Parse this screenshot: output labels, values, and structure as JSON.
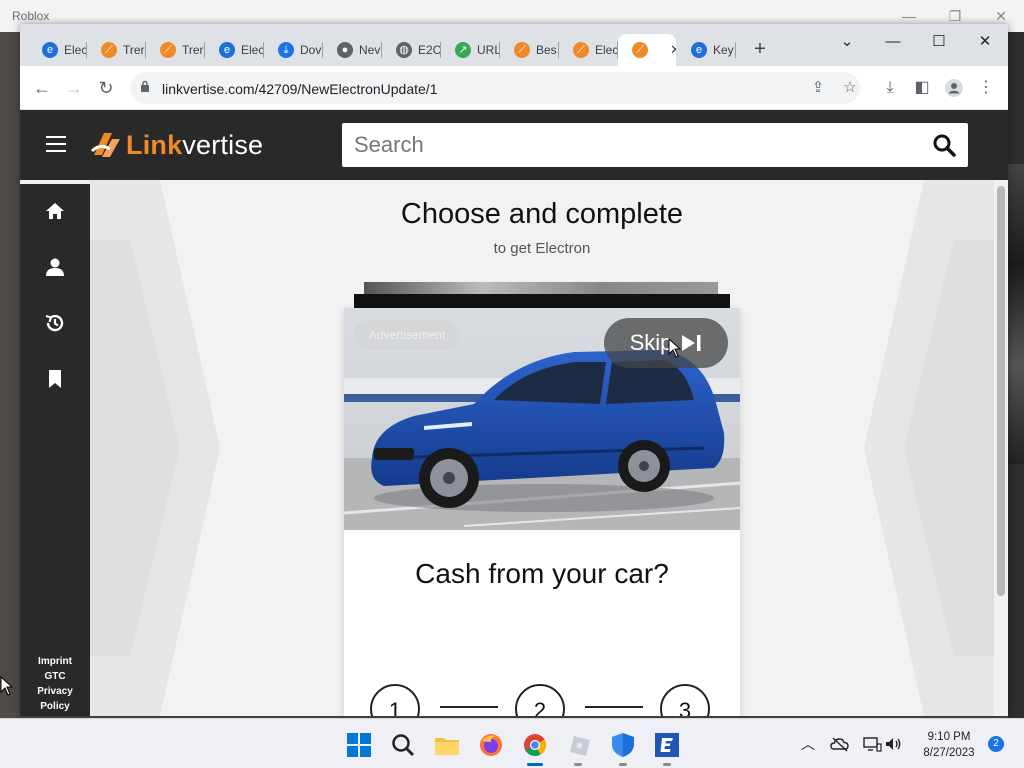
{
  "background_window": {
    "title": "Roblox"
  },
  "browser": {
    "tabs": [
      {
        "label": "Elec",
        "icon": "electron-icon",
        "active": false
      },
      {
        "label": "Trer",
        "icon": "linkvertise-icon",
        "active": false
      },
      {
        "label": "Trer",
        "icon": "linkvertise-icon",
        "active": false
      },
      {
        "label": "Elec",
        "icon": "electron-icon",
        "active": false
      },
      {
        "label": "Dov",
        "icon": "download-icon",
        "active": false
      },
      {
        "label": "Nev",
        "icon": "shield-icon",
        "active": false
      },
      {
        "label": "E2C",
        "icon": "globe-icon",
        "active": false
      },
      {
        "label": "URL",
        "icon": "link-icon",
        "active": false
      },
      {
        "label": "Bes",
        "icon": "linkvertise-icon",
        "active": false
      },
      {
        "label": "Elec",
        "icon": "linkvertise-icon",
        "active": false
      },
      {
        "label": "",
        "icon": "linkvertise-icon",
        "active": true,
        "close": "✕"
      },
      {
        "label": "Key",
        "icon": "electron-icon",
        "active": false
      }
    ],
    "new_tab": "+",
    "address": "linkvertise.com/42709/NewElectronUpdate/1"
  },
  "site": {
    "logo_bold": "Link",
    "logo_light": "vertise",
    "search_placeholder": "Search",
    "sidebar_links": [
      "Imprint",
      "GTC",
      "Privacy",
      "Policy"
    ]
  },
  "main": {
    "title": "Choose and complete",
    "subtitle": "to get Electron",
    "ad": {
      "badge": "Advertisement",
      "skip_label": "Skip",
      "headline": "Cash from your car?"
    },
    "steps": [
      "1",
      "2",
      "3"
    ]
  },
  "taskbar": {
    "time": "9:10 PM",
    "date": "8/27/2023",
    "notifications": "2"
  },
  "colors": {
    "brand_orange": "#f08a29",
    "header_dark": "#292929",
    "car_blue": "#1f4fb0"
  }
}
